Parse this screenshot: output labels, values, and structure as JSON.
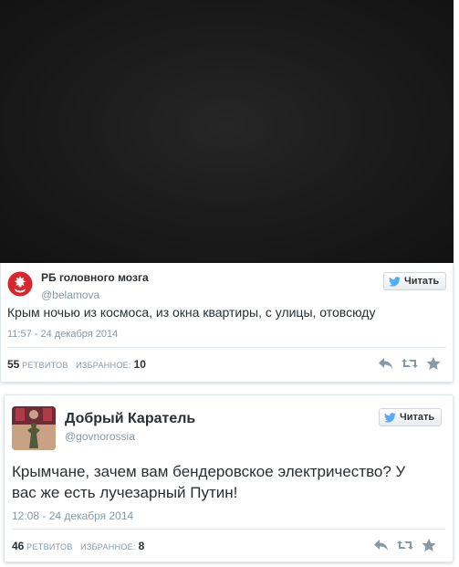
{
  "tweets": [
    {
      "name": "РБ головного мозга",
      "handle": "@belamova",
      "follow_label": "Читать",
      "text": "Крым ночью из космоса, из окна квартиры, с улицы, отовсюду",
      "time": "11:57 - 24 декабря 2014",
      "retweets": "55",
      "retweets_label": "РЕТВИТОВ",
      "favorites_label": "ИЗБРАННОЕ:",
      "favorites": "10"
    },
    {
      "name": "Добрый Каратель",
      "handle": "@govnorossia",
      "follow_label": "Читать",
      "text_line1": "Крымчане, зачем вам бендеровское электричество? У",
      "text_line2": "вас же есть лучезарный Путин!",
      "time": "12:08 - 24 декабря 2014",
      "retweets": "46",
      "retweets_label": "РЕТВИТОВ",
      "favorites_label": "ИЗБРАННОЕ:",
      "favorites": "8"
    }
  ],
  "colors": {
    "twitter_blue": "#55acee",
    "avatar_red": "#d9262c",
    "text": "#292f33",
    "muted": "#8899a6"
  },
  "icons": [
    "twitter-bird-icon",
    "reply-icon",
    "retweet-icon",
    "favorite-star-icon"
  ]
}
